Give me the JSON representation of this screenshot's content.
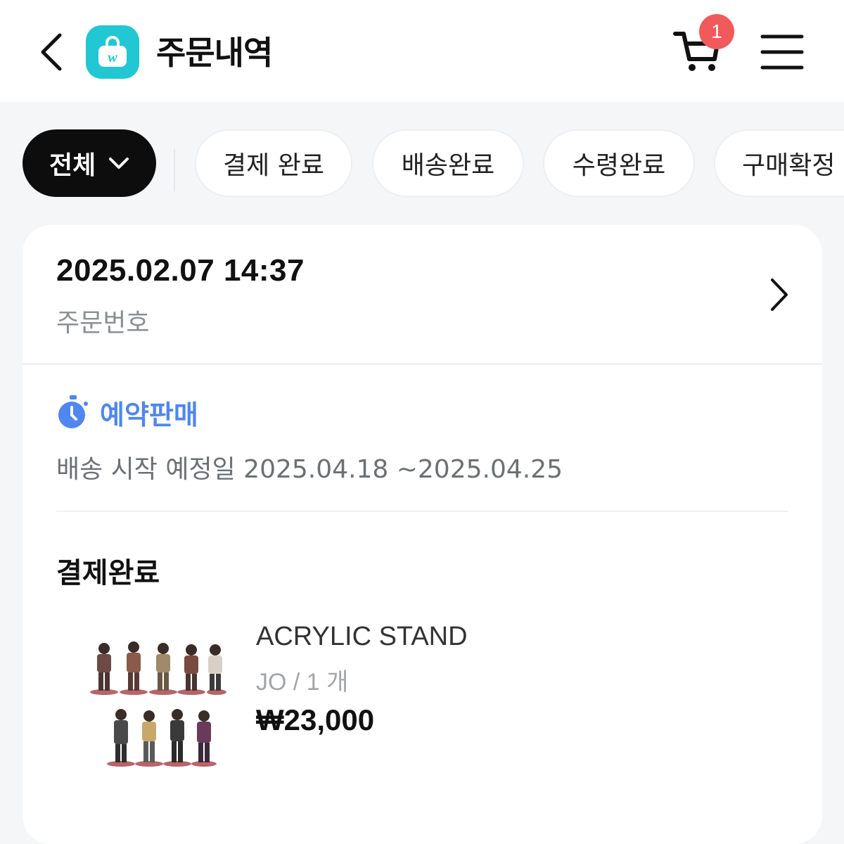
{
  "header": {
    "title": "주문내역",
    "logo_letter": "w",
    "cart_count": "1",
    "icons": {
      "back": "chevron-left-icon",
      "logo": "shopping-bag-icon",
      "cart": "cart-icon",
      "menu": "hamburger-menu-icon"
    }
  },
  "filters": {
    "selected": "전체",
    "items": [
      "결제 완료",
      "배송완료",
      "수령완료",
      "구매확정"
    ]
  },
  "order": {
    "date": "2025.02.07 14:37",
    "number_label": "주문번호",
    "preorder_label": "예약판매",
    "ship_schedule": "배송 시작 예정일 2025.04.18 ~2025.04.25",
    "status": "결제완료",
    "product": {
      "name": "ACRYLIC STAND",
      "option": "JO / 1 개",
      "price": "₩23,000"
    }
  },
  "colors": {
    "accent_blue": "#4f86f0",
    "logo_teal": "#21c7d3",
    "badge_red": "#f05a5a",
    "selected_chip": "#0d0d0d"
  }
}
